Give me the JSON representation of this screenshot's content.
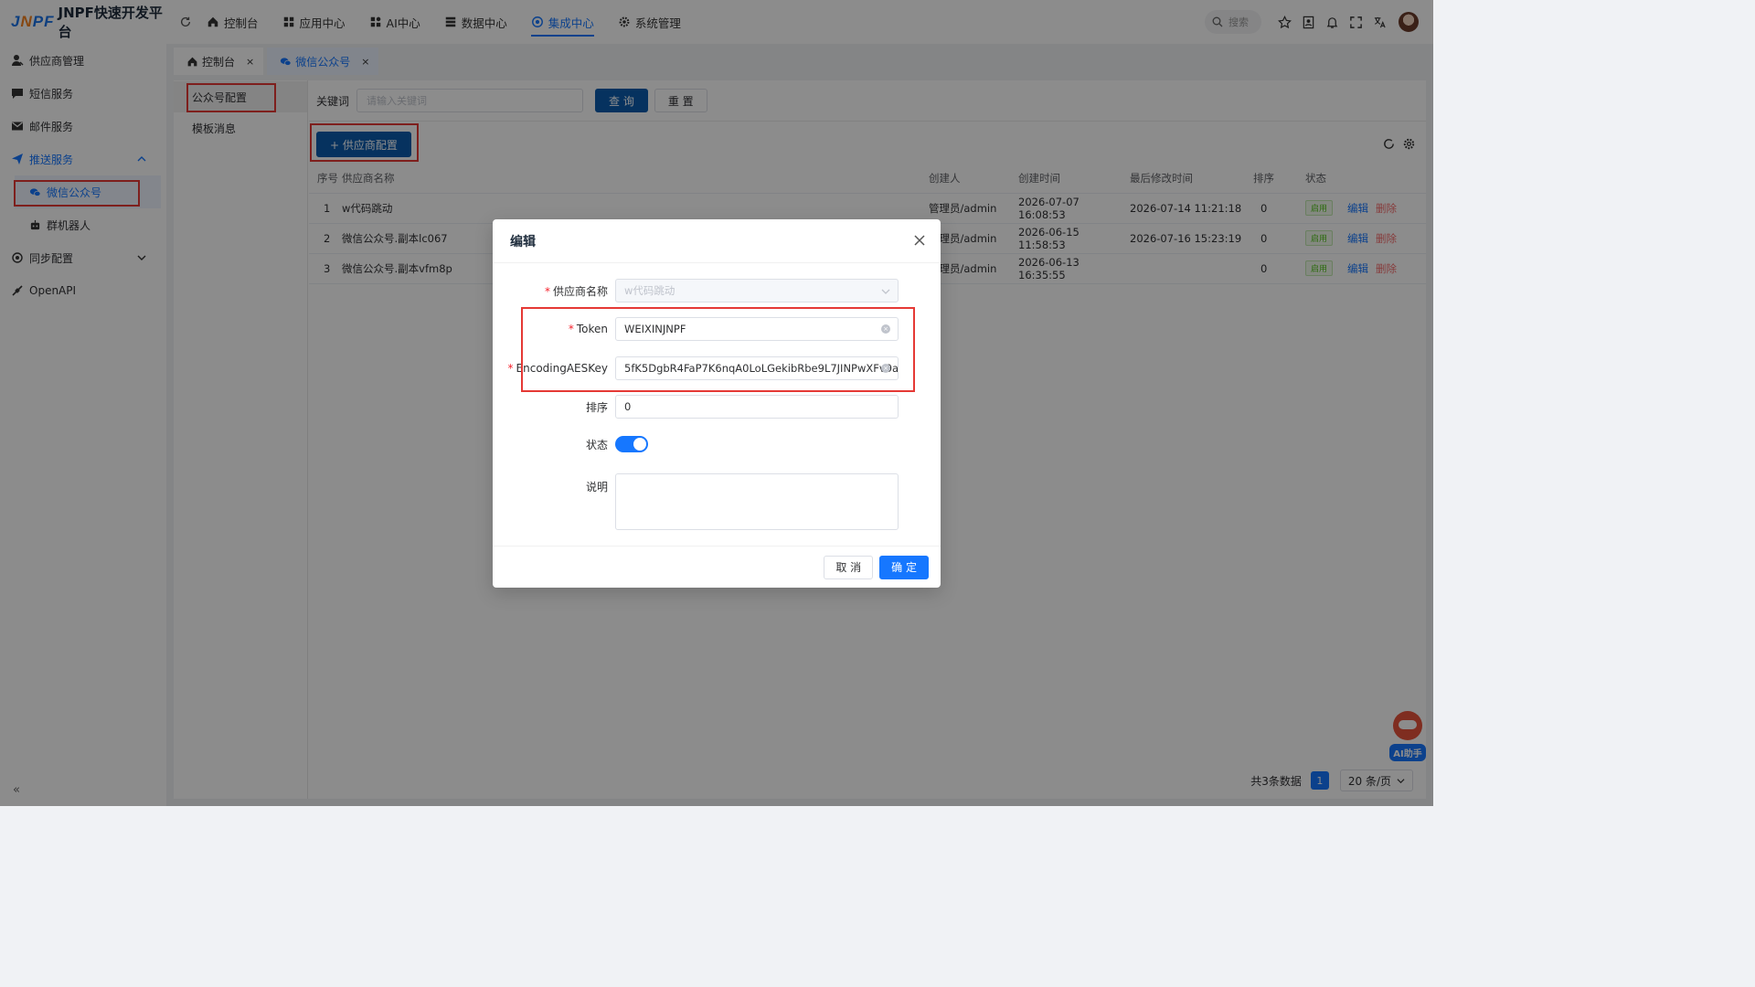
{
  "app": {
    "logo": "JNPF",
    "title": "JNPF快速开发平台"
  },
  "topnav": [
    {
      "label": "控制台",
      "icon": "home-icon"
    },
    {
      "label": "应用中心",
      "icon": "grid-icon"
    },
    {
      "label": "AI中心",
      "icon": "apps-icon"
    },
    {
      "label": "数据中心",
      "icon": "database-icon"
    },
    {
      "label": "集成中心",
      "icon": "integration-icon",
      "active": true
    },
    {
      "label": "系统管理",
      "icon": "gear-icon"
    }
  ],
  "search": {
    "placeholder": "搜索"
  },
  "sidebar": {
    "items": [
      {
        "label": "供应商管理",
        "icon": "user-icon"
      },
      {
        "label": "短信服务",
        "icon": "message-icon"
      },
      {
        "label": "邮件服务",
        "icon": "mail-icon"
      },
      {
        "label": "推送服务",
        "icon": "send-icon",
        "expanded": true
      },
      {
        "label": "微信公众号",
        "icon": "wechat-icon",
        "active": true
      },
      {
        "label": "群机器人",
        "icon": "robot-icon"
      },
      {
        "label": "同步配置",
        "icon": "sync-icon"
      },
      {
        "label": "OpenAPI",
        "icon": "api-icon"
      }
    ],
    "collapse": "«"
  },
  "tabs": [
    {
      "label": "控制台",
      "close": "×"
    },
    {
      "label": "微信公众号",
      "close": "×",
      "active": true
    }
  ],
  "subnav": [
    {
      "label": "公众号配置",
      "active": true
    },
    {
      "label": "模板消息"
    }
  ],
  "filter": {
    "keyword_label": "关键词",
    "keyword_placeholder": "请输入关键词",
    "query": "查 询",
    "reset": "重 置"
  },
  "toolbar": {
    "add": "+ 供应商配置"
  },
  "table": {
    "columns": [
      "序号",
      "供应商名称",
      "创建人",
      "创建时间",
      "最后修改时间",
      "排序",
      "状态"
    ],
    "rows": [
      {
        "no": "1",
        "name": "w代码跳动",
        "creator": "管理员/admin",
        "created": "2026-07-07 16:08:53",
        "modified": "2026-07-14 11:21:18",
        "sort": "0",
        "status": "启用"
      },
      {
        "no": "2",
        "name": "微信公众号.副本lc067",
        "creator": "管理员/admin",
        "created": "2026-06-15 11:58:53",
        "modified": "2026-07-16 15:23:19",
        "sort": "0",
        "status": "启用"
      },
      {
        "no": "3",
        "name": "微信公众号.副本vfm8p",
        "creator": "管理员/admin",
        "created": "2026-06-13 16:35:55",
        "modified": "",
        "sort": "0",
        "status": "启用"
      }
    ],
    "edit": "编辑",
    "delete": "删除"
  },
  "pager": {
    "total": "共3条数据",
    "page": "1",
    "size": "20 条/页"
  },
  "modal": {
    "title": "编辑",
    "fields": {
      "supplier_label": "供应商名称",
      "supplier_value": "w代码跳动",
      "token_label": "Token",
      "token_value": "WEIXINJNPF",
      "aes_label": "EncodingAESKey",
      "aes_value": "5fK5DgbR4FaP7K6nqA0LoLGekibRbe9L7JINPwXFv9a",
      "sort_label": "排序",
      "sort_value": "0",
      "status_label": "状态",
      "status_on": true,
      "desc_label": "说明",
      "desc_value": ""
    },
    "cancel": "取 消",
    "ok": "确 定"
  },
  "ai_assistant": {
    "label": "AI助手"
  },
  "colors": {
    "primary": "#1677ff",
    "danger": "#f56c6c",
    "highlight": "#e53935",
    "success": "#52c41a"
  }
}
